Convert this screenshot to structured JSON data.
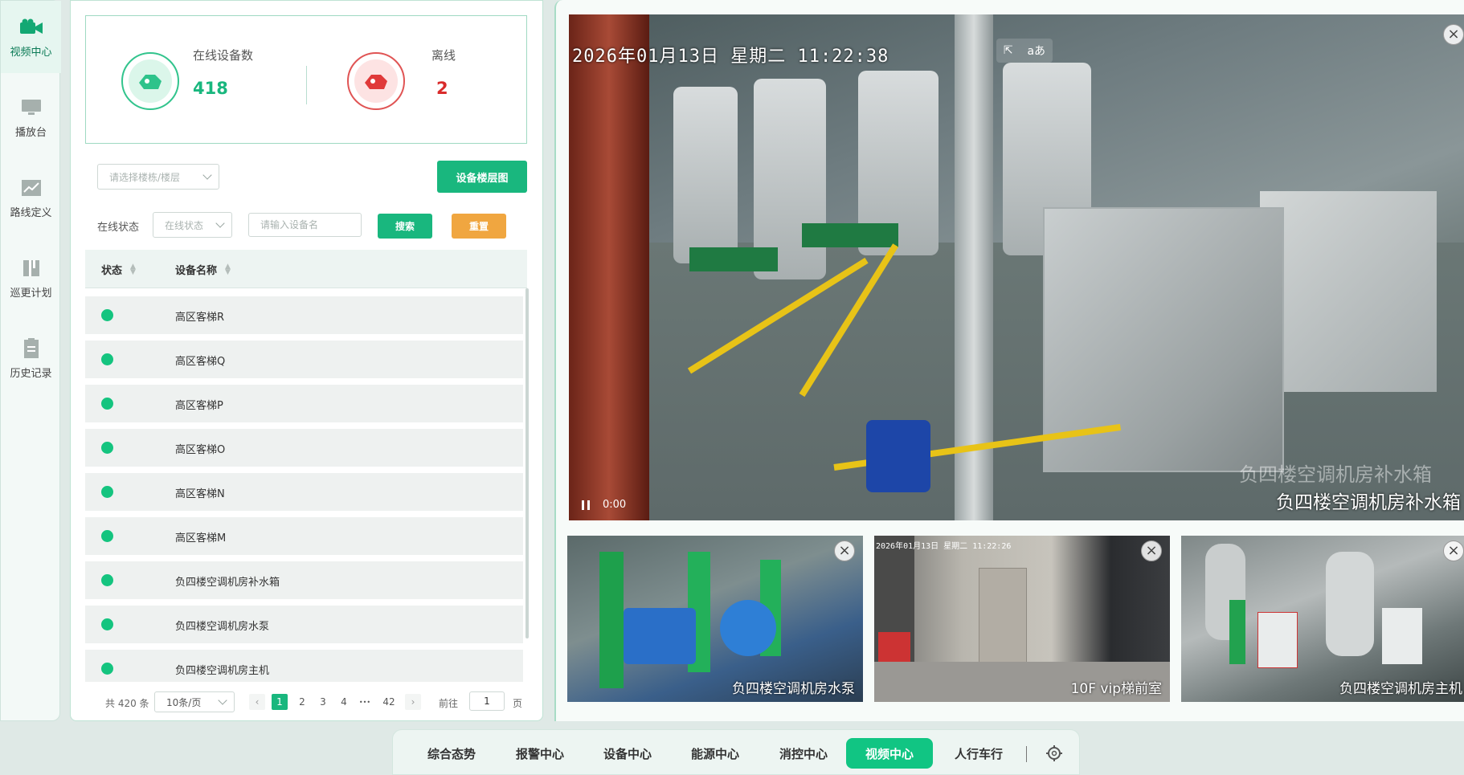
{
  "nav": {
    "items": [
      {
        "label": "视频中心",
        "icon": "camera-icon",
        "active": true
      },
      {
        "label": "播放台",
        "icon": "monitor-icon",
        "active": false
      },
      {
        "label": "路线定义",
        "icon": "line-chart-icon",
        "active": false
      },
      {
        "label": "巡更计划",
        "icon": "book-icon",
        "active": false
      },
      {
        "label": "历史记录",
        "icon": "document-icon",
        "active": false
      }
    ]
  },
  "stats": {
    "online_label": "在线设备数",
    "online_value": "418",
    "offline_label": "离线",
    "offline_value": "2",
    "online_color": "#19b77e",
    "offline_color": "#d92b2b"
  },
  "filters": {
    "building_placeholder": "请选择楼栋/楼层",
    "floor_map_button": "设备楼层图",
    "status_label": "在线状态",
    "status_placeholder": "在线状态",
    "device_placeholder": "请输入设备名",
    "search_button": "搜索",
    "reset_button": "重置"
  },
  "table": {
    "columns": [
      "状态",
      "设备名称"
    ],
    "rows": [
      {
        "status": "online",
        "name": "高区客梯R"
      },
      {
        "status": "online",
        "name": "高区客梯Q"
      },
      {
        "status": "online",
        "name": "高区客梯P"
      },
      {
        "status": "online",
        "name": "高区客梯O"
      },
      {
        "status": "online",
        "name": "高区客梯N"
      },
      {
        "status": "online",
        "name": "高区客梯M"
      },
      {
        "status": "online",
        "name": "负四楼空调机房补水箱"
      },
      {
        "status": "online",
        "name": "负四楼空调机房水泵"
      },
      {
        "status": "online",
        "name": "负四楼空调机房主机"
      }
    ]
  },
  "pagination": {
    "total": "共 420 条",
    "page_size": "10条/页",
    "pages": [
      "1",
      "2",
      "3",
      "4",
      "•••",
      "42"
    ],
    "current": "1",
    "goto_label": "前往",
    "goto_value": "1",
    "page_unit": "页"
  },
  "main_video": {
    "timestamp": "2026年01月13日  星期二  11:22:38",
    "time": "0:00",
    "name_ghost": "负四楼空调机房补水箱",
    "name": "负四楼空调机房补水箱",
    "header_icons": [
      "⇱",
      "aあ"
    ]
  },
  "thumbs": [
    {
      "label": "负四楼空调机房水泵",
      "stamp": ""
    },
    {
      "label": "10F vip梯前室",
      "stamp": "2026年01月13日 星期二 11:22:26"
    },
    {
      "label": "负四楼空调机房主机",
      "stamp": ""
    }
  ],
  "tabs": [
    {
      "label": "综合态势",
      "active": false
    },
    {
      "label": "报警中心",
      "active": false
    },
    {
      "label": "设备中心",
      "active": false
    },
    {
      "label": "能源中心",
      "active": false
    },
    {
      "label": "消控中心",
      "active": false
    },
    {
      "label": "视频中心",
      "active": true
    },
    {
      "label": "人行车行",
      "active": false
    }
  ],
  "settings_icon": "gear-icon"
}
